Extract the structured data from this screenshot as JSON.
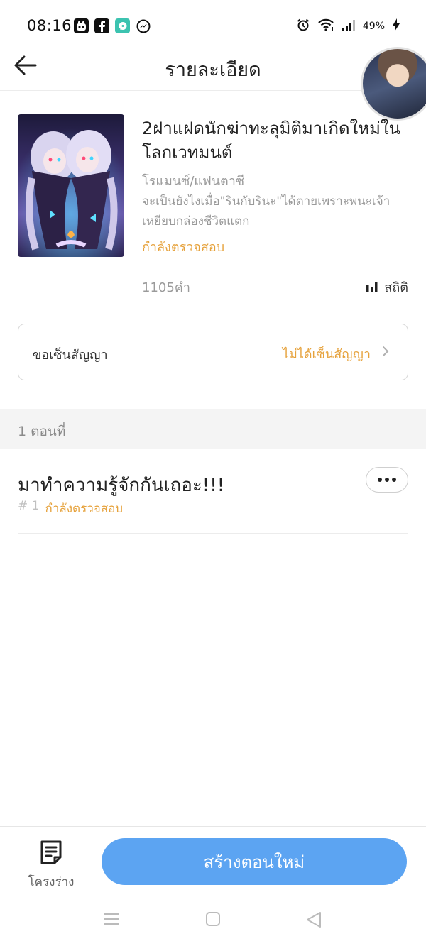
{
  "status_bar": {
    "time": "08:16",
    "battery": "49%",
    "app_icons": [
      "bubble-app-icon",
      "facebook-icon",
      "chat-app-icon",
      "messenger-icon"
    ]
  },
  "header": {
    "title": "รายละเอียด"
  },
  "book": {
    "title": "2ฝาแฝดนักฆ่าทะลุมิติมาเกิดใหม่ในโลกเวทมนต์",
    "genre": "โรแมนซ์/แฟนตาซี",
    "description": "จะเป็นยังไงเมื่อ\"รินกับรินะ\"ได้ตายเพราะพนะเจ้าเหยียบกล่องชีวิตแตก",
    "status": "กำลังตรวจสอบ",
    "word_count": "1105คำ",
    "stats_label": "สถิติ"
  },
  "contract": {
    "label": "ขอเซ็นสัญญา",
    "value": "ไม่ได้เซ็นสัญญา"
  },
  "chapters_section": {
    "header": "1 ตอนที่"
  },
  "chapters": [
    {
      "title": "มาทำความรู้จักกันเถอะ!!!",
      "number": "# 1",
      "status": "กำลังตรวจสอบ"
    }
  ],
  "bottom": {
    "outline_label": "โครงร่าง",
    "create_label": "สร้างตอนใหม่"
  },
  "colors": {
    "accent": "#5ca4f2",
    "status_orange": "#e6a23c",
    "muted_text": "#9a9a9a"
  }
}
